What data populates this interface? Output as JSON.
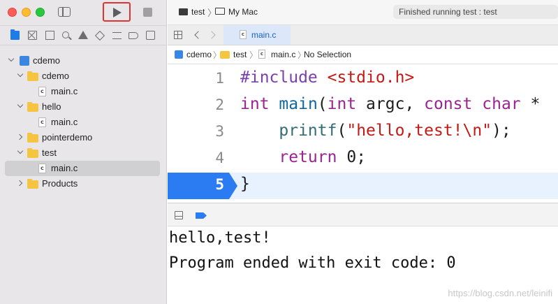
{
  "toolbar": {
    "scheme_target": "test",
    "scheme_device": "My Mac",
    "status": "Finished running test : test"
  },
  "navigator": {
    "items": [
      {
        "label": "cdemo",
        "kind": "project",
        "depth": 0,
        "expanded": true
      },
      {
        "label": "cdemo",
        "kind": "folder",
        "depth": 1,
        "expanded": true
      },
      {
        "label": "main.c",
        "kind": "file",
        "depth": 2
      },
      {
        "label": "hello",
        "kind": "folder",
        "depth": 1,
        "expanded": true
      },
      {
        "label": "main.c",
        "kind": "file",
        "depth": 2
      },
      {
        "label": "pointerdemo",
        "kind": "folder",
        "depth": 1,
        "expanded": false
      },
      {
        "label": "test",
        "kind": "folder",
        "depth": 1,
        "expanded": true
      },
      {
        "label": "main.c",
        "kind": "file",
        "depth": 2,
        "selected": true
      },
      {
        "label": "Products",
        "kind": "folder",
        "depth": 1,
        "expanded": false
      }
    ],
    "file_icon_letter": "c"
  },
  "tab": {
    "label": "main.c"
  },
  "jumpbar": {
    "project": "cdemo",
    "folder": "test",
    "file": "main.c",
    "symbol": "No Selection"
  },
  "editor": {
    "lines": [
      {
        "num": "1",
        "pp": "#include",
        "str": "<stdio.h>"
      },
      {
        "num": "2",
        "kw1": "int",
        "fn": "main",
        "p1": "(",
        "kw2": "int",
        "p2": " argc, ",
        "kw3": "const",
        "p3": " ",
        "kw4": "char",
        "p4": " *"
      },
      {
        "num": "3",
        "indent": "    ",
        "fn": "printf",
        "p1": "(",
        "str": "\"hello,test!\\n\"",
        "p2": ");"
      },
      {
        "num": "4",
        "indent": "    ",
        "kw": "return",
        "p1": " ",
        "num_lit": "0",
        "p2": ";"
      },
      {
        "num": "5",
        "text": "}"
      }
    ],
    "current_line": "5"
  },
  "console": {
    "lines": [
      "hello,test!",
      "Program ended with exit code: 0"
    ]
  },
  "watermark": "https://blog.csdn.net/leinifi",
  "colors": {
    "accent": "#2b7bf3",
    "highlight_box": "#e23232",
    "keyword": "#9b2393",
    "preprocessor": "#7b3faf",
    "string": "#c41a16",
    "function": "#326d74"
  }
}
